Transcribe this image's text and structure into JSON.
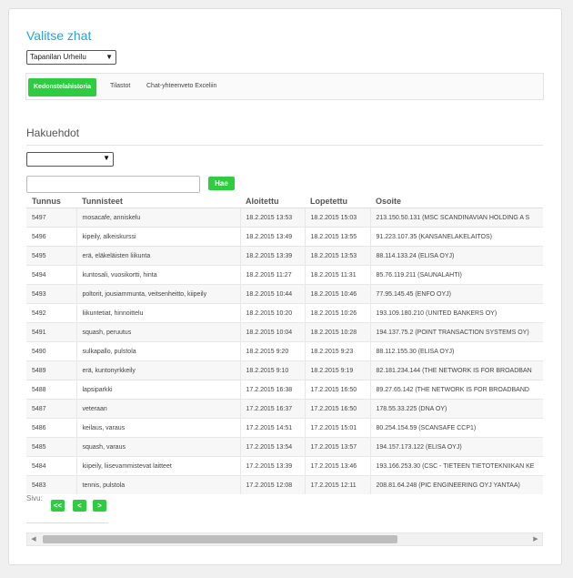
{
  "title": "Valitse zhat",
  "club_select": {
    "value": "Tapanilan Urheilu"
  },
  "tabs": [
    {
      "label": "Kedonstelahistoria",
      "active": true
    },
    {
      "label": "Tilastot",
      "active": false
    },
    {
      "label": "Chat-yhteenveto Exceliin",
      "active": false
    }
  ],
  "search": {
    "title": "Hakuehdot",
    "filter_value": "",
    "input_value": "",
    "button_label": "Hae"
  },
  "table": {
    "columns": [
      "Tunnus",
      "Tunnisteet",
      "Aloitettu",
      "Lopetettu",
      "Osoite"
    ],
    "rows": [
      [
        "5497",
        "mosacafe, anniskelu",
        "18.2.2015 13:53",
        "18.2.2015 15:03",
        "213.150.50.131 (MSC SCANDINAVIAN HOLDING A S"
      ],
      [
        "5496",
        "kipeily, alkeiskurssi",
        "18.2.2015 13:49",
        "18.2.2015 13:55",
        "91.223.107.35 (KANSANELAKELAITOS)"
      ],
      [
        "5495",
        "erä, eläkeläisten liikunta",
        "18.2.2015 13:39",
        "18.2.2015 13:53",
        "88.114.133.24 (ELISA OYJ)"
      ],
      [
        "5494",
        "kuntosali, vuosikortti, hinta",
        "18.2.2015 11:27",
        "18.2.2015 11:31",
        "85.76.119.211 (SAUNALAHTI)"
      ],
      [
        "5493",
        "poltorit, jousiammunta, veitsenheitto, kiipeily",
        "18.2.2015 10:44",
        "18.2.2015 10:46",
        "77.95.145.45 (ENFO OYJ)"
      ],
      [
        "5492",
        "liikuntetiat, hinnoittelu",
        "18.2.2015 10:20",
        "18.2.2015 10:26",
        "193.109.180.210 (UNITED BANKERS OY)"
      ],
      [
        "5491",
        "squash, peruutus",
        "18.2.2015 10:04",
        "18.2.2015 10:28",
        "194.137.75.2 (POINT TRANSACTION SYSTEMS OY)"
      ],
      [
        "5490",
        "sulkapallo, pulstola",
        "18.2.2015 9:20",
        "18.2.2015 9:23",
        "88.112.155.30 (ELISA OYJ)"
      ],
      [
        "5489",
        "erä, kuntonyrkkeily",
        "18.2.2015 9:10",
        "18.2.2015 9:19",
        "82.181.234.144 (THE NETWORK IS FOR BROADBAN"
      ],
      [
        "5488",
        "lapsiparkki",
        "17.2.2015 16:38",
        "17.2.2015 16:50",
        "89.27.65.142 (THE NETWORK IS FOR BROADBAND"
      ],
      [
        "5487",
        "veteraan",
        "17.2.2015 16:37",
        "17.2.2015 16:50",
        "178.55.33.225 (DNA OY)"
      ],
      [
        "5486",
        "keilaus, varaus",
        "17.2.2015 14:51",
        "17.2.2015 15:01",
        "80.254.154.59 (SCANSAFE CCP1)"
      ],
      [
        "5485",
        "squash, varaus",
        "17.2.2015 13:54",
        "17.2.2015 13:57",
        "194.157.173.122 (ELISA OYJ)"
      ],
      [
        "5484",
        "kiipeily, liisevammistevat laitteet",
        "17.2.2015 13:39",
        "17.2.2015 13:46",
        "193.166.253.30 (CSC - TIETEEN TIETOTEKNIIKAN KE"
      ],
      [
        "5483",
        "tennis, pulstola",
        "17.2.2015 12:08",
        "17.2.2015 12:11",
        "208.81.64.248 (PIC ENGINEERING OYJ YANTAA)"
      ]
    ]
  },
  "pager": {
    "label": "Sivu:",
    "first": "<<",
    "prev": "<",
    "next": ">"
  },
  "scrollbar": {
    "left_arrow": "◀",
    "right_arrow": "▶"
  },
  "colors": {
    "accent_green": "#2ecc40",
    "title_blue": "#29a3d6"
  }
}
